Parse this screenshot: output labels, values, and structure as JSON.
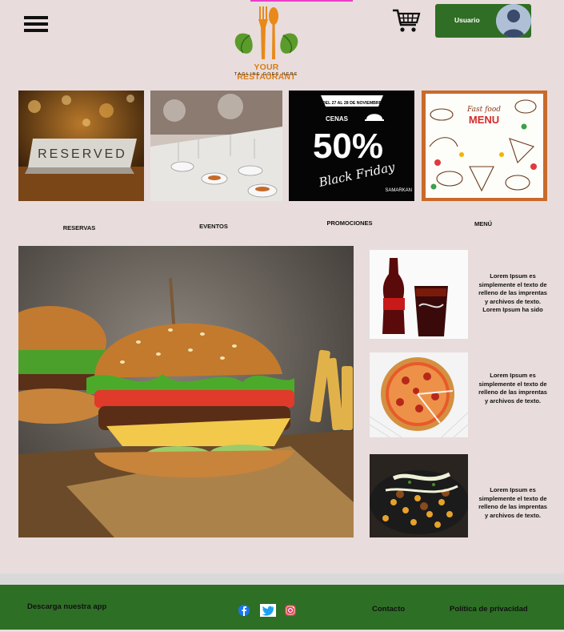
{
  "header": {
    "logo_name": "YOUR RESTAURANT",
    "logo_tagline": "TAGLINE GOES HERE",
    "user_label": "Usuario",
    "icons": [
      "menu-icon",
      "cart-icon",
      "avatar-icon"
    ]
  },
  "categories": [
    {
      "label": "RESERVAS",
      "image_text": "RESERVED"
    },
    {
      "label": "EVENTOS"
    },
    {
      "label": "PROMOCIONES",
      "image_texts": {
        "date": "DEL 27 AL 28 DE NOVIEMBRE",
        "title": "CENAS",
        "discount": "50%",
        "subtitle": "Black Friday",
        "brand": "SAMARKAN"
      }
    },
    {
      "label": "MENÚ",
      "image_texts": {
        "line1": "Fast food",
        "line2": "MENU"
      }
    }
  ],
  "side_items": [
    {
      "text": "Lorem Ipsum es simplemente el texto de relleno de las imprentas y archivos de texto. Lorem Ipsum ha sido"
    },
    {
      "text": "Lorem Ipsum es simplemente el texto de relleno de las imprentas y archivos de texto."
    },
    {
      "text": "Lorem Ipsum es simplemente el texto de relleno de las imprentas y archivos de texto."
    }
  ],
  "footer": {
    "download": "Descarga nuestra app",
    "contact": "Contacto",
    "privacy": "Política de privacidad",
    "social": [
      "facebook-icon",
      "twitter-icon",
      "instagram-icon"
    ]
  },
  "colors": {
    "background": "#e8dcdc",
    "brand_green": "#2e6f26",
    "logo_orange": "#e8891a",
    "logo_green": "#5a9a2a"
  }
}
